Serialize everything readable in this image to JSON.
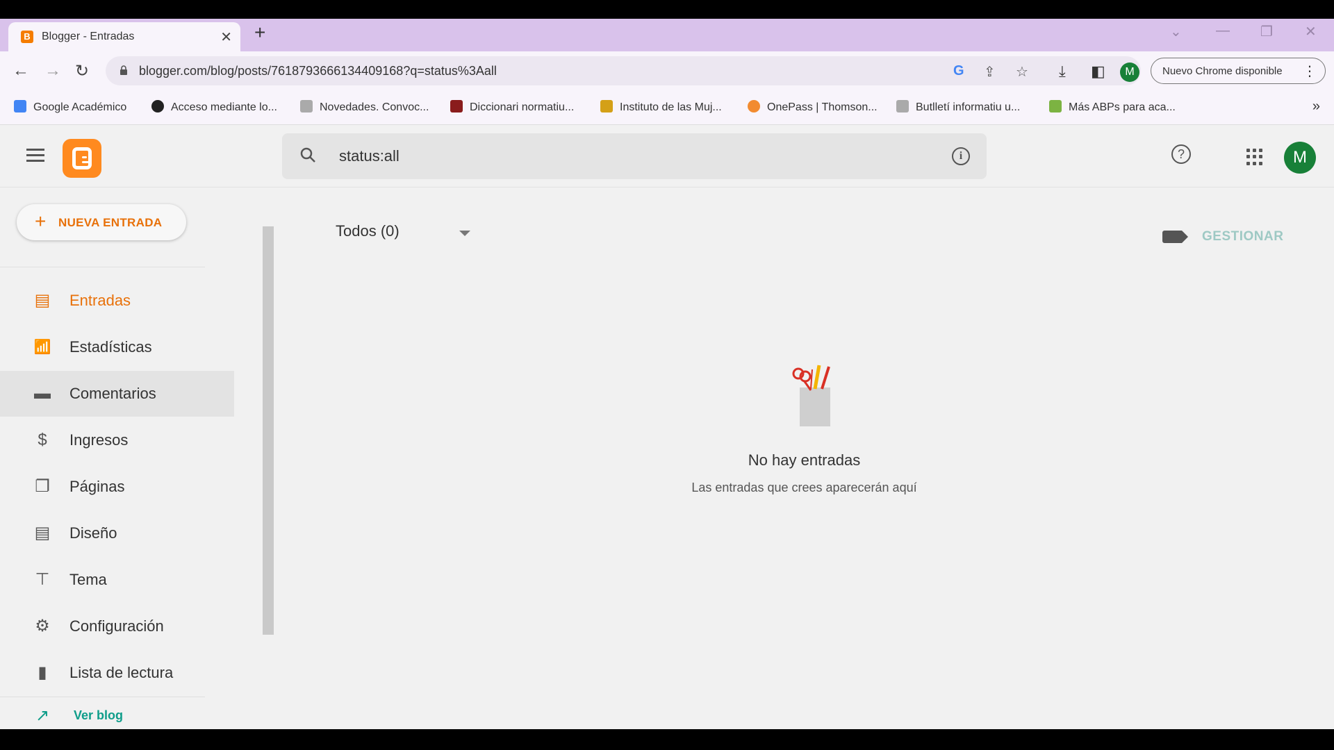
{
  "browser": {
    "tab_title": "Blogger - Entradas",
    "url": "blogger.com/blog/posts/7618793666134409168?q=status%3Aall",
    "update_chip": "Nuevo Chrome disponible",
    "profile_initial": "M",
    "bookmarks": [
      {
        "label": "Google Académico",
        "color": "#4285f4"
      },
      {
        "label": "Acceso mediante lo...",
        "color": "#222222"
      },
      {
        "label": "Novedades. Convoc...",
        "color": "#aaaaaa"
      },
      {
        "label": "Diccionari normatiu...",
        "color": "#8a1c1c"
      },
      {
        "label": "Instituto de las Muj...",
        "color": "#d4a017"
      },
      {
        "label": "OnePass | Thomson...",
        "color": "#f28b30"
      },
      {
        "label": "Butlletí informatiu u...",
        "color": "#aaaaaa"
      },
      {
        "label": "Más ABPs para aca...",
        "color": "#7cb342"
      }
    ]
  },
  "header": {
    "search_value": "status:all",
    "avatar_initial": "M"
  },
  "sidebar": {
    "new_post_label": "NUEVA ENTRADA",
    "items": [
      {
        "label": "Entradas",
        "icon": "posts-icon"
      },
      {
        "label": "Estadísticas",
        "icon": "stats-icon"
      },
      {
        "label": "Comentarios",
        "icon": "comments-icon"
      },
      {
        "label": "Ingresos",
        "icon": "earnings-icon"
      },
      {
        "label": "Páginas",
        "icon": "pages-icon"
      },
      {
        "label": "Diseño",
        "icon": "layout-icon"
      },
      {
        "label": "Tema",
        "icon": "theme-icon"
      },
      {
        "label": "Configuración",
        "icon": "settings-icon"
      },
      {
        "label": "Lista de lectura",
        "icon": "bookmark-icon"
      }
    ],
    "view_blog": "Ver blog"
  },
  "main": {
    "filter_label": "Todos (0)",
    "manage_label": "GESTIONAR",
    "empty_title": "No hay entradas",
    "empty_subtitle": "Las entradas que crees aparecerán aquí"
  },
  "colors": {
    "accent": "#e8710a",
    "brand": "#ff8a1f",
    "avatar": "#188038",
    "tabbar": "#d9c2eb"
  }
}
